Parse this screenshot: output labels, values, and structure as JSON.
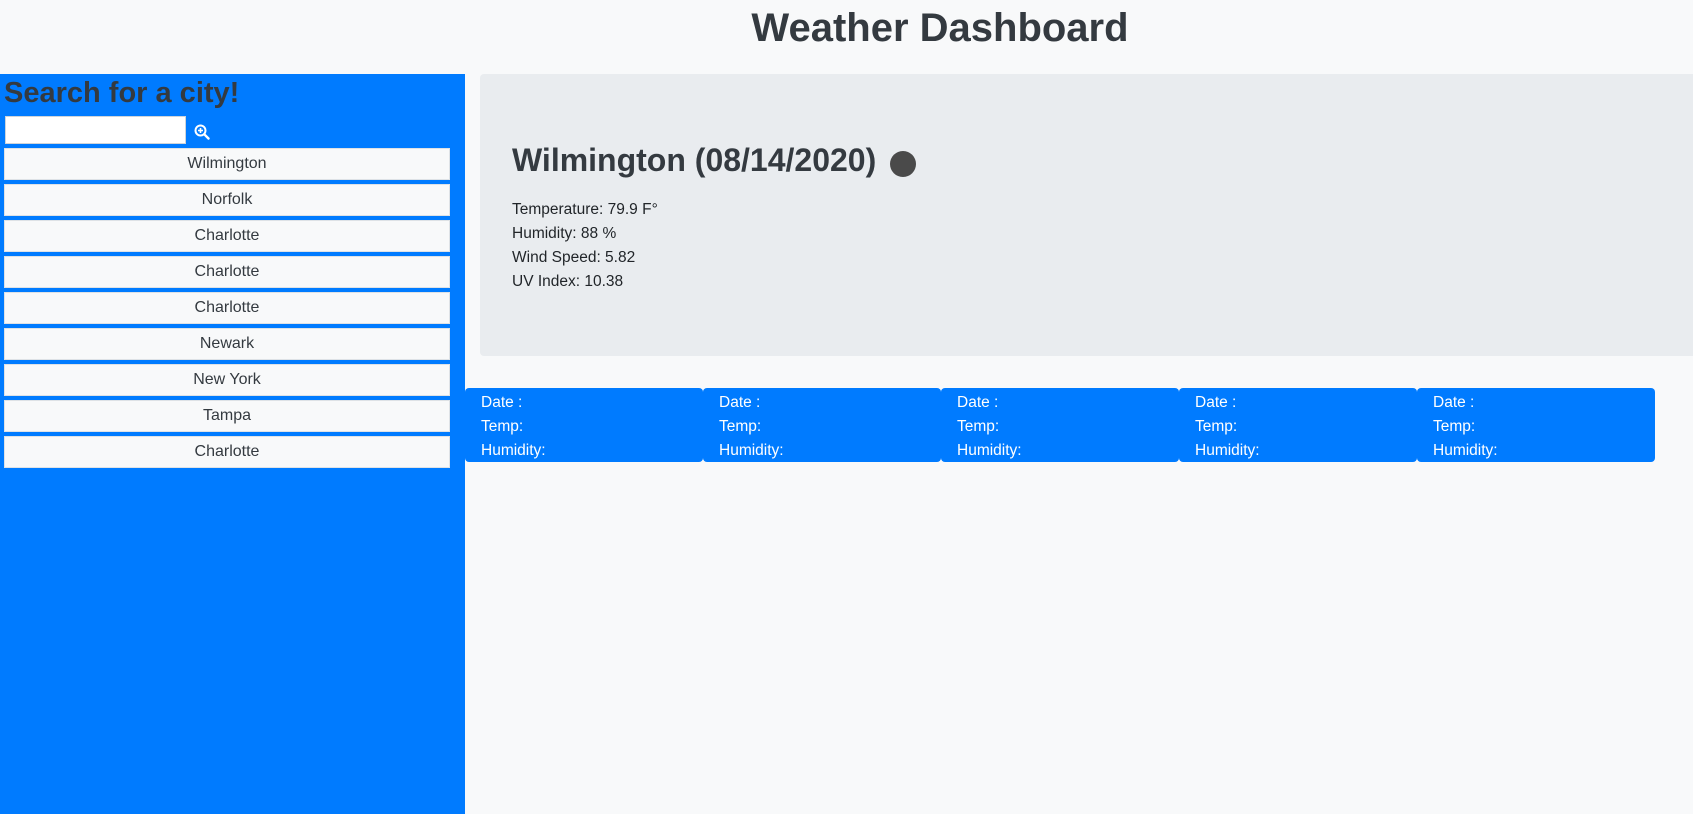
{
  "header": {
    "title": "Weather Dashboard"
  },
  "sidebar": {
    "heading": "Search for a city!",
    "search": {
      "value": "",
      "placeholder": "",
      "button_icon": "search-zoom-icon"
    },
    "cities": [
      "Wilmington",
      "Norfolk",
      "Charlotte",
      "Charlotte",
      "Charlotte",
      "Newark",
      "New York",
      "Tampa",
      "Charlotte"
    ]
  },
  "current": {
    "title": "Wilmington (08/14/2020)",
    "temperature": "Temperature: 79.9 F°",
    "humidity": "Humidity: 88 %",
    "wind": "Wind Speed: 5.82",
    "uv": "UV Index: 10.38",
    "icon": "weather-icon"
  },
  "forecast": [
    {
      "date": "Date :",
      "temp": "Temp:",
      "humidity": "Humidity:"
    },
    {
      "date": "Date :",
      "temp": "Temp:",
      "humidity": "Humidity:"
    },
    {
      "date": "Date :",
      "temp": "Temp:",
      "humidity": "Humidity:"
    },
    {
      "date": "Date :",
      "temp": "Temp:",
      "humidity": "Humidity:"
    },
    {
      "date": "Date :",
      "temp": "Temp:",
      "humidity": "Humidity:"
    }
  ],
  "colors": {
    "primary": "#007bff",
    "panel": "#e9ecef",
    "background": "#f8f9fa",
    "text": "#343a40"
  }
}
